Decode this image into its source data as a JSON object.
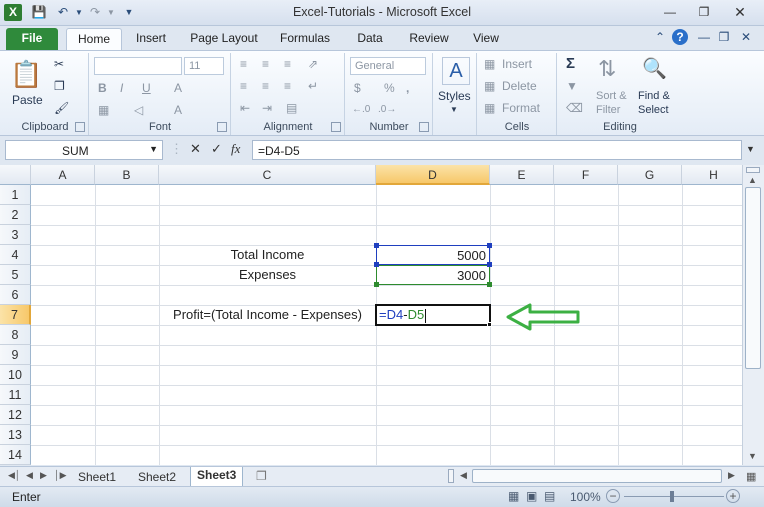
{
  "window": {
    "title": "Excel-Tutorials  -  Microsoft Excel",
    "app_icon": "excel-logo-icon",
    "controls": [
      "minimize-icon",
      "restore-icon",
      "close-icon"
    ]
  },
  "ribbon_tabs": [
    "File",
    "Home",
    "Insert",
    "Page Layout",
    "Formulas",
    "Data",
    "Review",
    "View"
  ],
  "active_tab": "Home",
  "ribbon": {
    "clipboard": {
      "paste": "Paste",
      "label": "Clipboard"
    },
    "font": {
      "name": "",
      "size": "11",
      "bold": "B",
      "italic": "I",
      "underline": "U",
      "grow": "A",
      "label": "Font"
    },
    "alignment": {
      "label": "Alignment"
    },
    "number": {
      "format": "General",
      "currency": "$",
      "percent": "%",
      "comma": ",",
      "label": "Number"
    },
    "styles": {
      "label": "Styles"
    },
    "cells": {
      "insert": "Insert",
      "delete": "Delete",
      "format": "Format",
      "label": "Cells"
    },
    "editing": {
      "sum": "Σ",
      "sort_filter_1": "Sort &",
      "sort_filter_2": "Filter",
      "find_select_1": "Find &",
      "find_select_2": "Select",
      "label": "Editing"
    }
  },
  "formula_bar": {
    "name_box": "SUM",
    "cancel": "✕",
    "enter": "✓",
    "fx": "fx",
    "content": "=D4-D5"
  },
  "grid": {
    "columns": [
      "A",
      "B",
      "C",
      "D",
      "E",
      "F",
      "G",
      "H"
    ],
    "selected_column": "D",
    "rows": [
      "1",
      "2",
      "3",
      "4",
      "5",
      "6",
      "7",
      "8",
      "9",
      "10",
      "11",
      "12",
      "13",
      "14"
    ],
    "selected_row": "7",
    "cells": {
      "C4": "Total Income",
      "D4": "5000",
      "C5": "Expenses",
      "D5": "3000",
      "C7": "Profit=(Total Income - Expenses)",
      "D7_ref1": "=D4",
      "D7_op": "-",
      "D7_ref2": "D5"
    },
    "ref_colors": {
      "D4": "#1f3fbf",
      "D5": "#2e8b2e"
    }
  },
  "annotation": {
    "arrow_color": "#3cb043"
  },
  "sheets": [
    "Sheet1",
    "Sheet2",
    "Sheet3"
  ],
  "active_sheet": "Sheet3",
  "status": {
    "mode": "Enter",
    "zoom": "100%"
  }
}
